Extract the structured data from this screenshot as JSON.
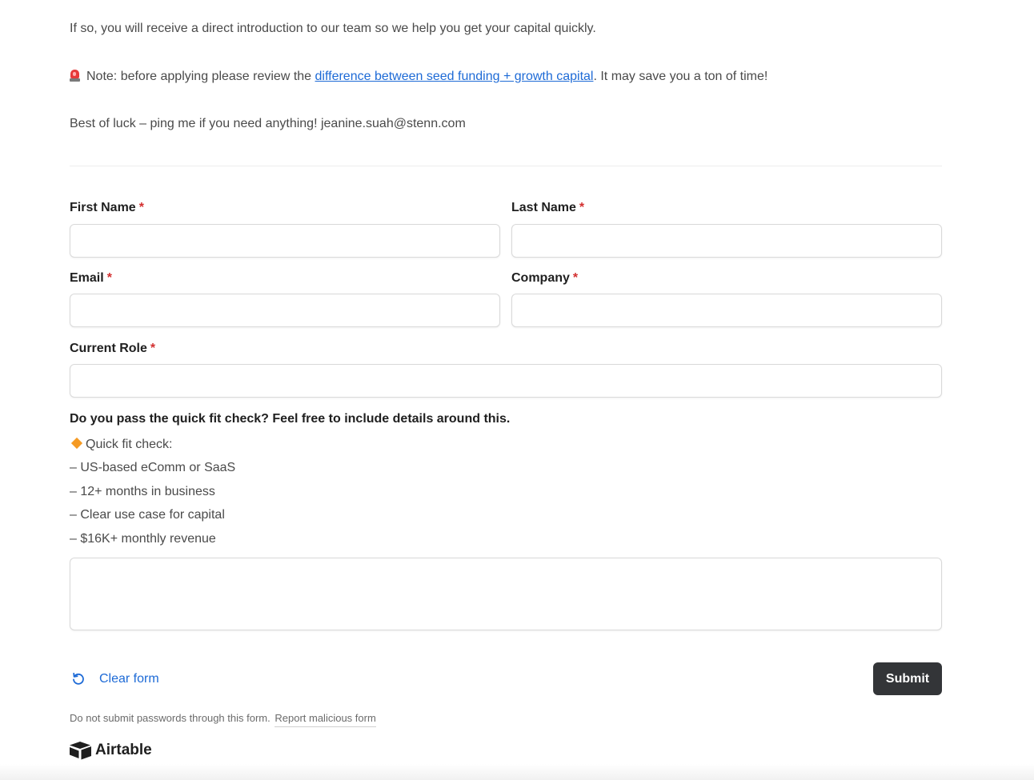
{
  "intro": {
    "line1": "If so, you will receive a direct introduction to our team so we help you get your capital quickly.",
    "note_prefix": "Note: before applying please review the ",
    "note_link": "difference between seed funding + growth capital",
    "note_suffix": ". It may save you a ton of time!",
    "closing": "Best of luck – ping me if you need anything! jeanine.suah@stenn.com"
  },
  "form": {
    "required_marker": "*",
    "first_name": {
      "label": "First Name",
      "value": ""
    },
    "last_name": {
      "label": "Last Name",
      "value": ""
    },
    "email": {
      "label": "Email",
      "value": ""
    },
    "company": {
      "label": "Company",
      "value": ""
    },
    "current_role": {
      "label": "Current Role",
      "value": ""
    },
    "fit_check": {
      "label": "Do you pass the quick fit check? Feel free to include details around this.",
      "heading": "Quick fit check:",
      "items": [
        "– US-based eComm or SaaS",
        "– 12+ months in business",
        "– Clear use case for capital",
        "– $16K+ monthly revenue"
      ],
      "value": ""
    }
  },
  "actions": {
    "clear_label": "Clear form",
    "submit_label": "Submit"
  },
  "footer": {
    "note": "Do not submit passwords through this form.",
    "report_link": "Report malicious form",
    "brand": "Airtable"
  },
  "icons": {
    "note": "siren-icon",
    "fit_check": "orange-diamond-icon",
    "clear": "reset-icon",
    "brand": "airtable-logo-icon"
  },
  "colors": {
    "link": "#1d6ad6",
    "required": "#d32f2f",
    "submit_bg": "#333538"
  }
}
